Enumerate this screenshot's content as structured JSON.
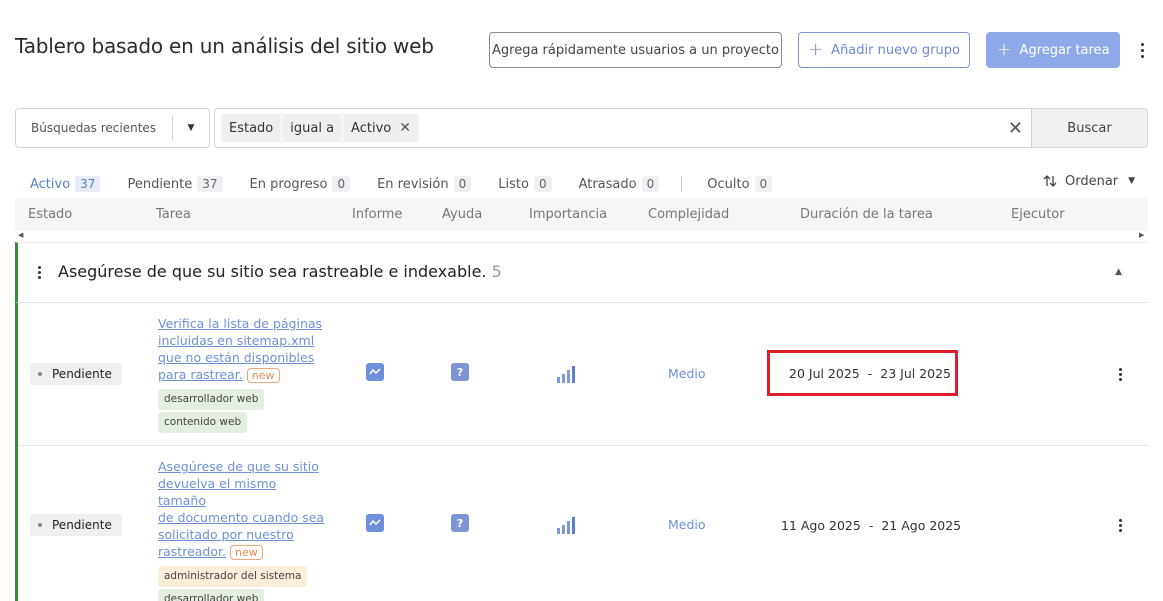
{
  "header": {
    "title": "Tablero basado en un análisis del sitio web",
    "quick_add_label": "Agrega rápidamente usuarios a un proyecto",
    "add_group_label": "Añadir nuevo grupo",
    "add_task_label": "Agregar tarea"
  },
  "filters": {
    "recent_label": "Búsquedas recientes",
    "chips": [
      "Estado",
      "igual a",
      "Activo"
    ],
    "search_label": "Buscar"
  },
  "tabs": [
    {
      "label": "Activo",
      "count": "37"
    },
    {
      "label": "Pendiente",
      "count": "37"
    },
    {
      "label": "En progreso",
      "count": "0"
    },
    {
      "label": "En revisión",
      "count": "0"
    },
    {
      "label": "Listo",
      "count": "0"
    },
    {
      "label": "Atrasado",
      "count": "0"
    },
    {
      "label": "Oculto",
      "count": "0"
    }
  ],
  "sort_label": "Ordenar",
  "columns": [
    "Estado",
    "Tarea",
    "Informe",
    "Ayuda",
    "Importancia",
    "Complejidad",
    "Duración de la tarea",
    "Ejecutor"
  ],
  "group": {
    "title": "Asegúrese de que su sitio sea rastreable e indexable.",
    "count": "5"
  },
  "rows": [
    {
      "status": "Pendiente",
      "task_lines": [
        "Verifica la lista de páginas",
        "incluidas en sitemap.xml",
        "que no están disponibles",
        "para rastrear."
      ],
      "badge": "new",
      "tags": [
        "desarrollador web",
        "contenido web"
      ],
      "complexity": "Medio",
      "start": "20 Jul 2025",
      "end": "23 Jul 2025"
    },
    {
      "status": "Pendiente",
      "task_lines": [
        "Asegúrese de que su sitio",
        "devuelva el mismo tamaño",
        "de documento cuando sea",
        "solicitado por nuestro",
        "rastreador."
      ],
      "badge": "new",
      "tags": [
        "administrador del sistema",
        "desarrollador web"
      ],
      "complexity": "Medio",
      "start": "11 Ago 2025",
      "end": "21 Ago 2025"
    }
  ],
  "icons": {
    "report": "chart-line-icon",
    "help": "question-icon",
    "importance": "signal-bars-icon"
  },
  "help_glyph": "?",
  "colors": {
    "accent": "#6f8fd8",
    "group_bar": "#3a8a3a",
    "highlight": "#e01e2a"
  }
}
